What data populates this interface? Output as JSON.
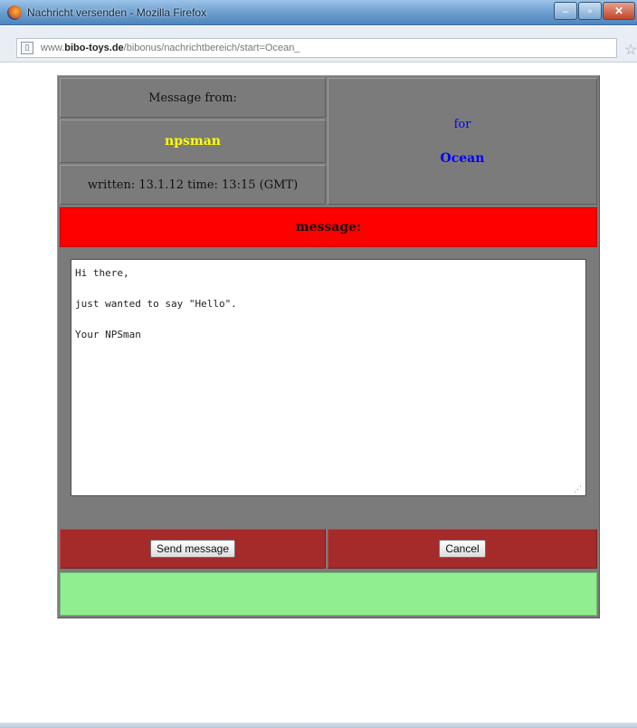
{
  "browser": {
    "title": "Nachricht versenden - Mozilla Firefox",
    "url_prefix": "www.",
    "url_domain": "bibo-toys.de",
    "url_path": "/bibonus/nachrichtbereich/start=Ocean_",
    "window_buttons": {
      "minimize": "–",
      "maximize": "▫",
      "close": "✕"
    }
  },
  "message": {
    "from_label": "Message from:",
    "sender": "npsman",
    "written_info": "written: 13.1.12 time: 13:15 (GMT)",
    "for_label": "for",
    "recipient": "Ocean",
    "section_title": "message:",
    "body": "Hi there,\n\njust wanted to say \"Hello\".\n\nYour NPSman"
  },
  "actions": {
    "send_label": "Send message",
    "cancel_label": "Cancel"
  },
  "colors": {
    "panel": "#7b7b7b",
    "message_bar": "#ff0000",
    "action_bar": "#a52a2a",
    "status_bar": "#90ee90",
    "sender_text": "#ffff00",
    "recipient_text": "#0000ff"
  },
  "icons": {
    "page": "page-icon",
    "star": "star-icon",
    "browser": "firefox-icon"
  }
}
